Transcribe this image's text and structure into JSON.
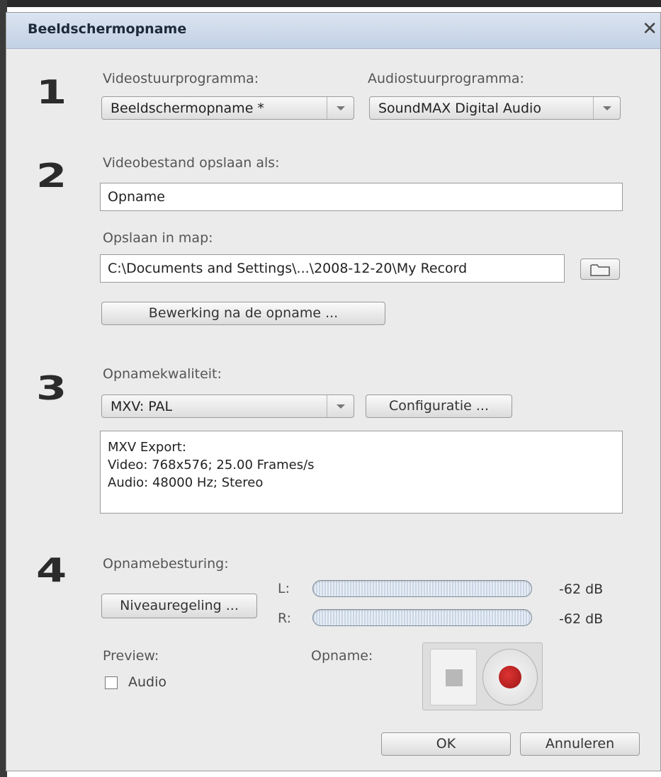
{
  "dialog": {
    "title": "Beeldschermopname"
  },
  "steps": [
    "1",
    "2",
    "3",
    "4"
  ],
  "section1": {
    "video_driver_label": "Videostuurprogramma:",
    "video_driver_value": "Beeldschermopname *",
    "audio_driver_label": "Audiostuurprogramma:",
    "audio_driver_value": "SoundMAX Digital Audio"
  },
  "section2": {
    "save_as_label": "Videobestand opslaan als:",
    "save_as_value": "Opname",
    "folder_label": "Opslaan in map:",
    "folder_value": "C:\\Documents and Settings\\...\\2008-12-20\\My Record",
    "post_edit_button": "Bewerking na de opname ..."
  },
  "section3": {
    "quality_label": "Opnamekwaliteit:",
    "quality_value": "MXV: PAL",
    "config_button": "Configuratie ...",
    "info_lines": [
      "MXV Export:",
      "Video: 768x576; 25.00 Frames/s",
      "Audio: 48000 Hz; Stereo"
    ]
  },
  "section4": {
    "control_label": "Opnamebesturing:",
    "level_button": "Niveauregeling ...",
    "left_label": "L:",
    "right_label": "R:",
    "left_db": "-62 dB",
    "right_db": "-62 dB",
    "preview_label": "Preview:",
    "audio_checkbox_label": "Audio",
    "audio_checked": false,
    "record_label": "Opname:"
  },
  "footer": {
    "ok_button": "OK",
    "cancel_button": "Annuleren"
  },
  "colors": {
    "record_dot": "#b81d1d",
    "titlebar": "#c9d6e8"
  }
}
